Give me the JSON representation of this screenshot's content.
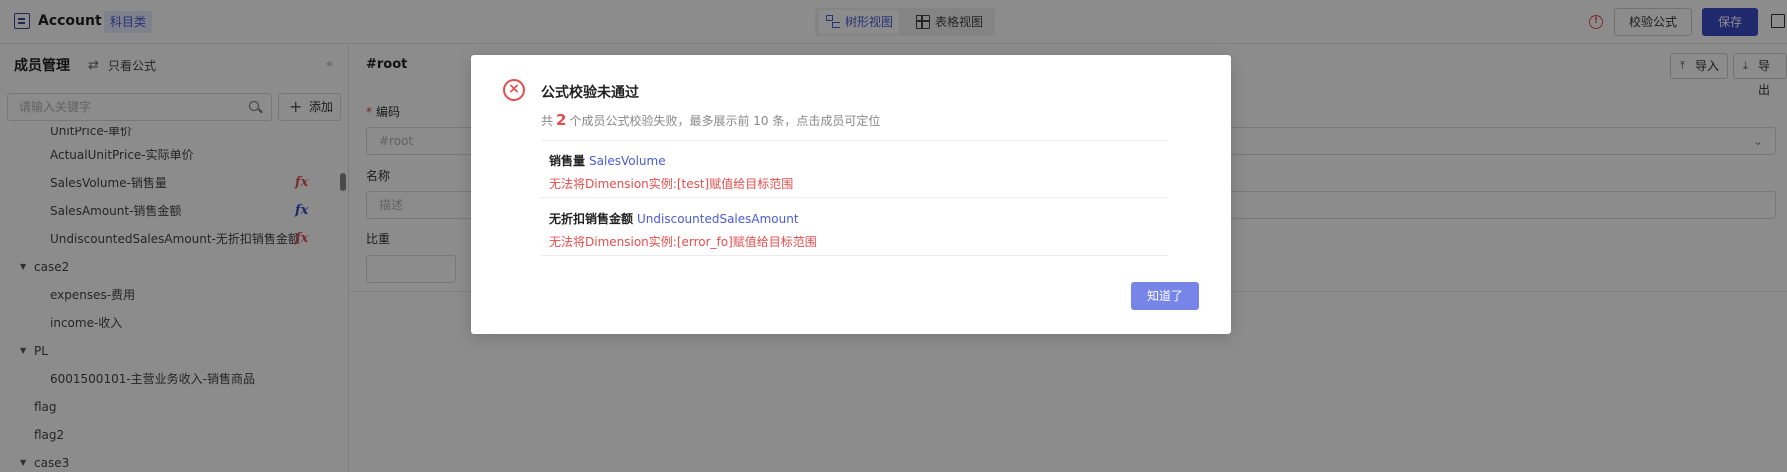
{
  "header": {
    "title": "Account",
    "tag": "科目类",
    "views": [
      {
        "label": "树形视图",
        "icon": "tree-view-icon",
        "active": true
      },
      {
        "label": "表格视图",
        "icon": "table-view-icon",
        "active": false
      }
    ],
    "validate_label": "校验公式",
    "save_label": "保存",
    "warning_icon": "warning-icon",
    "book_icon": "book-icon"
  },
  "sidebar": {
    "title": "成员管理",
    "formula_toggle_label": "只看公式",
    "search_placeholder": "请输入关键字",
    "add_label": "添加",
    "items": [
      {
        "label": "UnitPrice-单价",
        "level": 2,
        "fx": null
      },
      {
        "label": "ActualUnitPrice-实际单价",
        "level": 2,
        "fx": null
      },
      {
        "label": "SalesVolume-销售量",
        "level": 2,
        "fx": "error"
      },
      {
        "label": "SalesAmount-销售金额",
        "level": 2,
        "fx": "ok"
      },
      {
        "label": "UndiscountedSalesAmount-无折扣销售金额",
        "level": 2,
        "fx": "error"
      },
      {
        "label": "case2",
        "level": 1,
        "expanded": true
      },
      {
        "label": "expenses-费用",
        "level": 2,
        "fx": null
      },
      {
        "label": "income-收入",
        "level": 2,
        "fx": null
      },
      {
        "label": "PL",
        "level": 1,
        "expanded": true
      },
      {
        "label": "6001500101-主营业务收入-销售商品",
        "level": 2,
        "fx": null
      },
      {
        "label": "flag",
        "level": 1,
        "fx": null
      },
      {
        "label": "flag2",
        "level": 1,
        "fx": null
      },
      {
        "label": "case3",
        "level": 1,
        "expanded": true
      }
    ],
    "fx_symbol": "fx",
    "colors": {
      "fx_error": "#e05050",
      "fx_ok": "#3b4cc9"
    }
  },
  "main": {
    "title": "#root",
    "import_label": "导入",
    "export_label": "导出",
    "code_label": "编码",
    "code_value": "#root",
    "name_label": "名称",
    "name_placeholder": "描述",
    "weight_label": "比重"
  },
  "dialog": {
    "title": "公式校验未通过",
    "sub_prefix": "共",
    "count": "2",
    "sub_suffix": "个成员公式校验失败，最多展示前 10 条，点击成员可定位",
    "errors": [
      {
        "name": "销售量",
        "code": "SalesVolume",
        "message": "无法将Dimension实例:[test]赋值给目标范围"
      },
      {
        "name": "无折扣销售金额",
        "code": "UndiscountedSalesAmount",
        "message": "无法将Dimension实例:[error_fo]赋值给目标范围"
      }
    ],
    "ok_label": "知道了"
  }
}
